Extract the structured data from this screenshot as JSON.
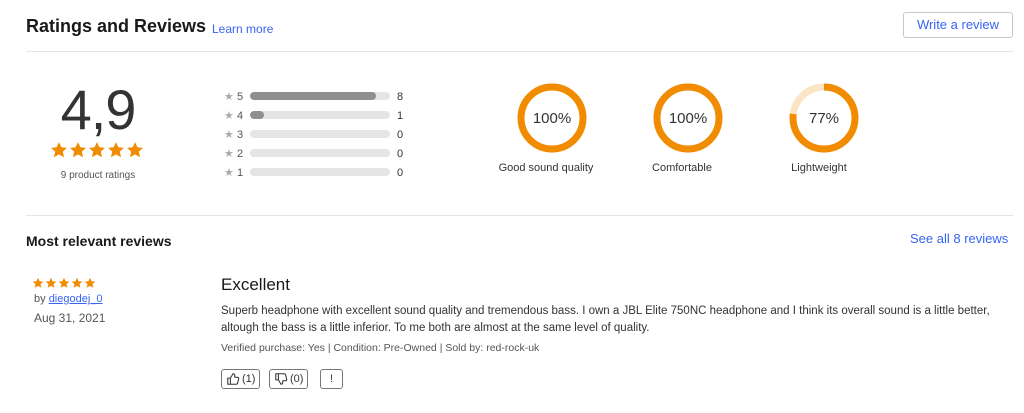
{
  "header": {
    "title": "Ratings and Reviews",
    "learn_more": "Learn more",
    "write_review": "Write a review"
  },
  "summary": {
    "average": "4,9",
    "stars": 5,
    "ratings_count": "9 product ratings"
  },
  "histogram": [
    {
      "stars": "5",
      "count": "8",
      "fraction": 0.9
    },
    {
      "stars": "4",
      "count": "1",
      "fraction": 0.1
    },
    {
      "stars": "3",
      "count": "0",
      "fraction": 0
    },
    {
      "stars": "2",
      "count": "0",
      "fraction": 0
    },
    {
      "stars": "1",
      "count": "0",
      "fraction": 0
    }
  ],
  "attributes": [
    {
      "label": "Good sound quality",
      "percent_text": "100%",
      "percent": 100
    },
    {
      "label": "Comfortable",
      "percent_text": "100%",
      "percent": 100
    },
    {
      "label": "Lightweight",
      "percent_text": "77%",
      "percent": 77
    }
  ],
  "reviews_section": {
    "title": "Most relevant reviews",
    "see_all": "See all 8 reviews"
  },
  "review": {
    "stars": 5,
    "by_prefix": "by",
    "author": "diegodej_0",
    "date": "Aug 31, 2021",
    "title": "Excellent",
    "body": "Superb headphone with excellent sound quality and tremendous bass. I own a JBL Elite 750NC headphone and I think its overall sound is a little better, altough the bass is a little inferior. To me both are almost at the same level of quality.",
    "meta": "Verified purchase: Yes | Condition: Pre-Owned | Sold by: red-rock-uk",
    "helpful_count": "(1)",
    "unhelpful_count": "(0)",
    "report_label": "!"
  },
  "colors": {
    "accent": "#3665f3",
    "star": "#f18c00",
    "gauge": "#f18c00",
    "gauge_track": "#fbe5c4",
    "bar_fill": "#8f8f8f",
    "bar_track": "#e5e5e5"
  }
}
